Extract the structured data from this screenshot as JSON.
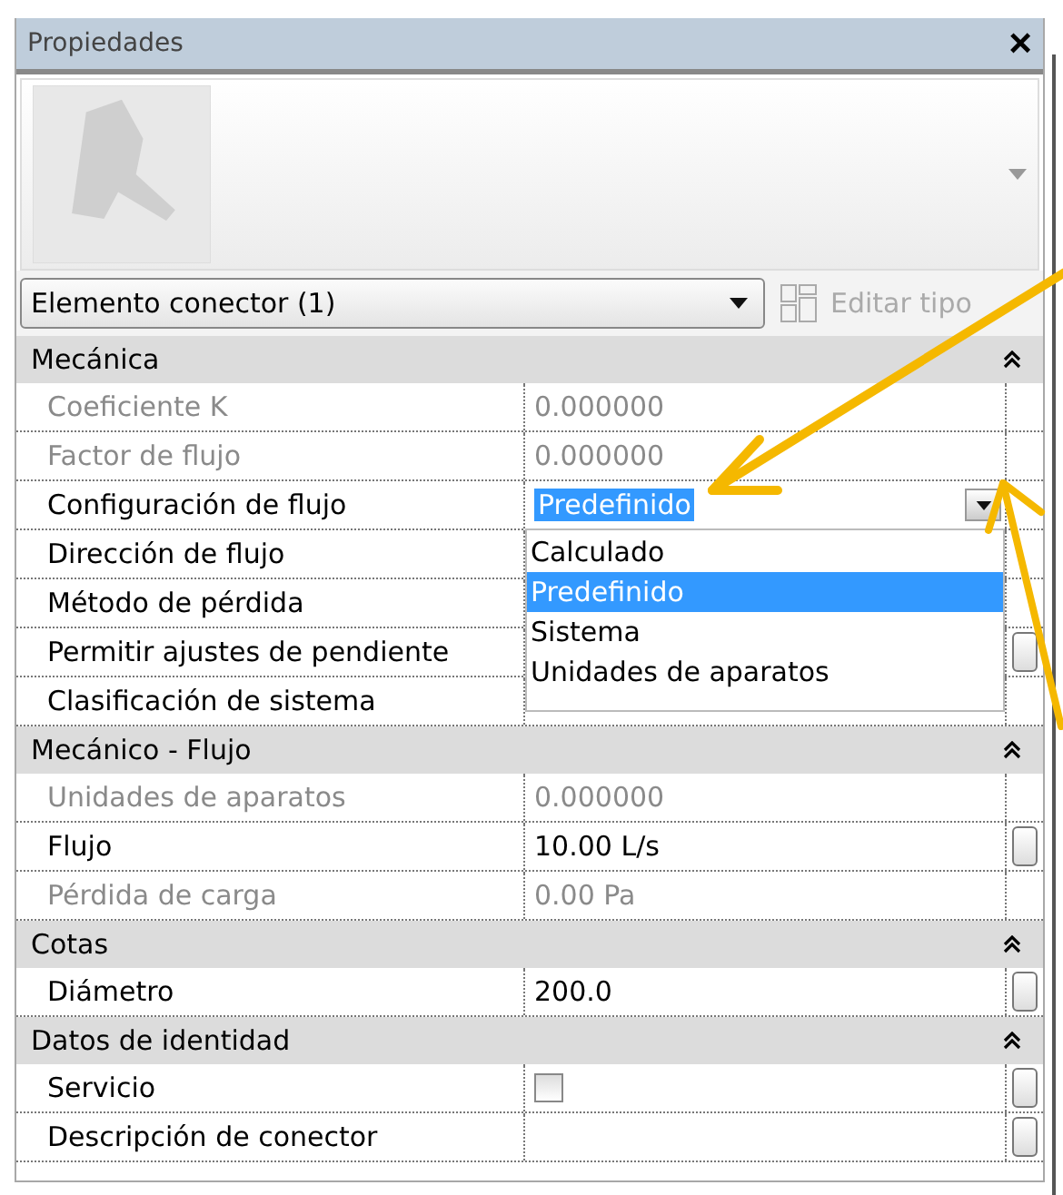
{
  "panel": {
    "title": "Propiedades",
    "close": "×"
  },
  "type_selector": {
    "value": "Elemento conector (1)",
    "edit_type": "Editar tipo",
    "edit_disabled": true
  },
  "sections": [
    {
      "title": "Mecánica",
      "expanded": true,
      "rows": [
        {
          "label": "Coeficiente K",
          "value": "0.000000",
          "kind": "text",
          "disabled": true,
          "button": false
        },
        {
          "label": "Factor de flujo",
          "value": "0.000000",
          "kind": "text",
          "disabled": true,
          "button": false
        },
        {
          "label": "Configuración de flujo",
          "value": "Predefinido",
          "kind": "dropdown",
          "disabled": false,
          "button": false,
          "open": true,
          "options": [
            {
              "label": "Calculado",
              "selected": false
            },
            {
              "label": "Predefinido",
              "selected": true
            },
            {
              "label": "Sistema",
              "selected": false
            },
            {
              "label": "Unidades de aparatos",
              "selected": false
            }
          ]
        },
        {
          "label": "Dirección de flujo",
          "kind": "text",
          "disabled": false,
          "button": false
        },
        {
          "label": "Método de pérdida",
          "kind": "text",
          "disabled": false,
          "button": false
        },
        {
          "label": "Permitir ajustes de pendiente",
          "kind": "text",
          "disabled": false,
          "button": true
        },
        {
          "label": "Clasificación de sistema",
          "kind": "text",
          "disabled": false,
          "button": false
        }
      ]
    },
    {
      "title": "Mecánico - Flujo",
      "expanded": true,
      "rows": [
        {
          "label": "Unidades de aparatos",
          "value": "0.000000",
          "kind": "text",
          "disabled": true,
          "button": false
        },
        {
          "label": "Flujo",
          "value": "10.00 L/s",
          "kind": "text",
          "disabled": false,
          "button": true
        },
        {
          "label": "Pérdida de carga",
          "value": "0.00 Pa",
          "kind": "text",
          "disabled": true,
          "button": false
        }
      ]
    },
    {
      "title": "Cotas",
      "expanded": true,
      "rows": [
        {
          "label": "Diámetro",
          "value": "200.0",
          "kind": "text",
          "disabled": false,
          "button": true
        }
      ]
    },
    {
      "title": "Datos de identidad",
      "expanded": true,
      "rows": [
        {
          "label": "Servicio",
          "kind": "checkbox",
          "checked": false,
          "disabled": false,
          "button": true
        },
        {
          "label": "Descripción de conector",
          "kind": "text",
          "disabled": false,
          "button": true
        }
      ]
    }
  ]
}
